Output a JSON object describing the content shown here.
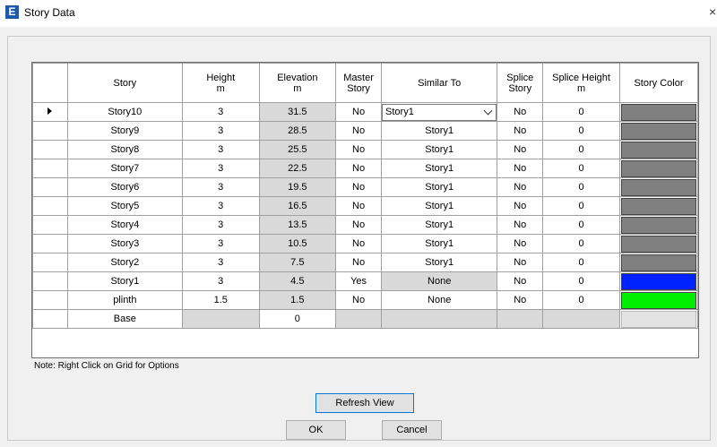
{
  "window": {
    "title": "Story Data",
    "app_icon": "E"
  },
  "columns": [
    "",
    "Story",
    "Height\nm",
    "Elevation\nm",
    "Master\nStory",
    "Similar To",
    "Splice\nStory",
    "Splice Height\nm",
    "Story Color"
  ],
  "rows": [
    {
      "story": "Story10",
      "height": "3",
      "elevation": "31.5",
      "master": "No",
      "similar": "Story1",
      "splice": "No",
      "splice_height": "0",
      "color": "#808080",
      "selected": true
    },
    {
      "story": "Story9",
      "height": "3",
      "elevation": "28.5",
      "master": "No",
      "similar": "Story1",
      "splice": "No",
      "splice_height": "0",
      "color": "#808080"
    },
    {
      "story": "Story8",
      "height": "3",
      "elevation": "25.5",
      "master": "No",
      "similar": "Story1",
      "splice": "No",
      "splice_height": "0",
      "color": "#808080"
    },
    {
      "story": "Story7",
      "height": "3",
      "elevation": "22.5",
      "master": "No",
      "similar": "Story1",
      "splice": "No",
      "splice_height": "0",
      "color": "#808080"
    },
    {
      "story": "Story6",
      "height": "3",
      "elevation": "19.5",
      "master": "No",
      "similar": "Story1",
      "splice": "No",
      "splice_height": "0",
      "color": "#808080"
    },
    {
      "story": "Story5",
      "height": "3",
      "elevation": "16.5",
      "master": "No",
      "similar": "Story1",
      "splice": "No",
      "splice_height": "0",
      "color": "#808080"
    },
    {
      "story": "Story4",
      "height": "3",
      "elevation": "13.5",
      "master": "No",
      "similar": "Story1",
      "splice": "No",
      "splice_height": "0",
      "color": "#808080"
    },
    {
      "story": "Story3",
      "height": "3",
      "elevation": "10.5",
      "master": "No",
      "similar": "Story1",
      "splice": "No",
      "splice_height": "0",
      "color": "#808080"
    },
    {
      "story": "Story2",
      "height": "3",
      "elevation": "7.5",
      "master": "No",
      "similar": "Story1",
      "splice": "No",
      "splice_height": "0",
      "color": "#808080"
    },
    {
      "story": "Story1",
      "height": "3",
      "elevation": "4.5",
      "master": "Yes",
      "similar": "None",
      "splice": "No",
      "splice_height": "0",
      "color": "#0022ff"
    },
    {
      "story": "plinth",
      "height": "1.5",
      "elevation": "1.5",
      "master": "No",
      "similar": "None",
      "splice": "No",
      "splice_height": "0",
      "color": "#00ee00"
    },
    {
      "story": "Base",
      "height": "",
      "elevation": "0",
      "master": "",
      "similar": "",
      "splice": "",
      "splice_height": "",
      "color": "#e3e3e3",
      "is_base": true
    }
  ],
  "note": "Note:  Right Click on Grid for Options",
  "buttons": {
    "refresh": "Refresh View",
    "ok": "OK",
    "cancel": "Cancel"
  }
}
